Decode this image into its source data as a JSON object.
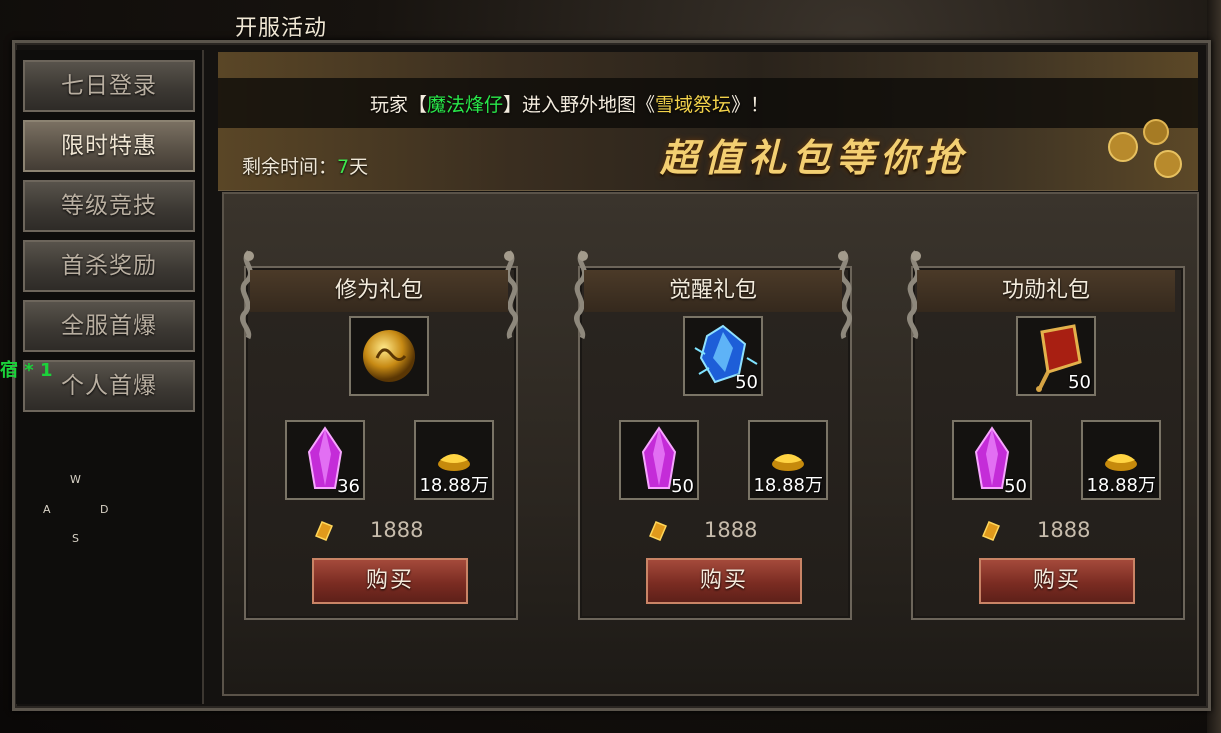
{
  "window": {
    "title": "开服活动"
  },
  "sidebar": {
    "items": [
      {
        "label": "七日登录",
        "active": false
      },
      {
        "label": "限时特惠",
        "active": true
      },
      {
        "label": "等级竞技",
        "active": false
      },
      {
        "label": "首杀奖励",
        "active": false
      },
      {
        "label": "全服首爆",
        "active": false
      },
      {
        "label": "个人首爆",
        "active": false
      }
    ],
    "side_note": "宿 * 1"
  },
  "controls": {
    "w": "W",
    "a": "A",
    "s": "S",
    "d": "D"
  },
  "banner": {
    "broadcast_prefix": "玩家【",
    "player": "魔法烽仔",
    "broadcast_mid": "】进入野外地图《",
    "map": "雪域祭坛",
    "broadcast_suffix": "》！",
    "slogan": "超值礼包等你抢",
    "time_label": "剩余时间：",
    "time_value": "7",
    "time_unit": "天"
  },
  "packs": [
    {
      "title": "修为礼包",
      "main_icon": "gold-orb-icon",
      "main_count": "",
      "crystal_count": "36",
      "gold_count": "18.88万",
      "price": "1888",
      "buy_label": "购买"
    },
    {
      "title": "觉醒礼包",
      "main_icon": "blue-crystal-icon",
      "main_count": "50",
      "crystal_count": "50",
      "gold_count": "18.88万",
      "price": "1888",
      "buy_label": "购买"
    },
    {
      "title": "功勋礼包",
      "main_icon": "merit-token-icon",
      "main_count": "50",
      "crystal_count": "50",
      "gold_count": "18.88万",
      "price": "1888",
      "buy_label": "购买"
    }
  ],
  "colors": {
    "accent_green": "#29e84a",
    "accent_yellow": "#f2d24b",
    "buy_red": "#8a3327",
    "slogan_gold": "#f3cf72"
  }
}
